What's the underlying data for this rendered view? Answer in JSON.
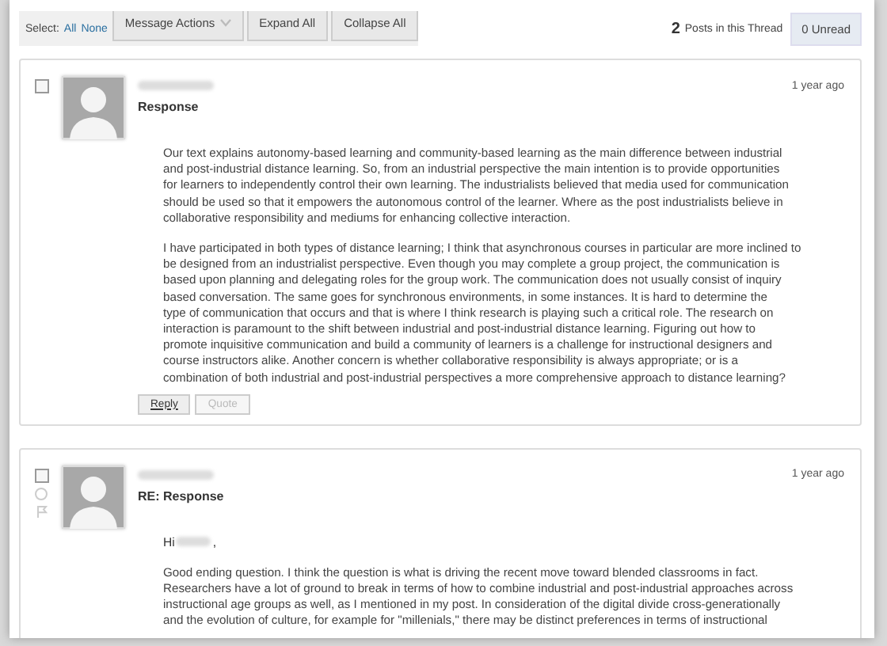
{
  "toolbar": {
    "select_label": "Select:",
    "select_links": [
      "All",
      "None"
    ],
    "buttons": [
      {
        "label": "Message Actions",
        "kind": "dropdown"
      },
      {
        "label": "Expand All",
        "kind": "plain"
      },
      {
        "label": "Collapse All",
        "kind": "plain"
      }
    ],
    "post_count": "2",
    "post_count_label": "Posts in this Thread",
    "unread": "0 Unread"
  },
  "posts": [
    {
      "checked": false,
      "time": "1 year ago",
      "subject": "Response",
      "paragraphs": [
        [
          "Our text explains autonomy-based learning and community-based learning as the main difference between industrial",
          "and post-industrial distance learning.  So, from an industrial perspective the main intention is to provide opportunities",
          "for learners to independently control their own learning.  The industrialists believed that media used for communication",
          "should be used so that it empowers the autonomous control of the learner.  Where as the post industrialists believe in",
          "collaborative responsibility and mediums for enhancing collective interaction."
        ],
        [
          "I have participated in both types of distance learning; I think that asynchronous courses in particular are more inclined to",
          "be designed from an industrialist perspective.  Even though you may complete a group project, the communication is",
          "based upon planning and delegating roles for the group work.  The communication does not usually consist of inquiry",
          "based conversation.  The same goes for synchronous environments, in some instances.  It is hard to determine the",
          "type of communication that occurs and that is where I think research is playing such a critical role.  The research on",
          "interaction is paramount to the shift between industrial and post-industrial distance learning.  Figuring out how to",
          "promote inquisitive communication and build a community of learners is a challenge for instructional designers and",
          "course instructors alike.  Another concern is whether collaborative responsibility is always appropriate; or is a",
          "combination of both industrial and post-industrial perspectives a more comprehensive approach to distance learning?"
        ]
      ],
      "actions": [
        {
          "label": "Reply",
          "disabled": false
        },
        {
          "label": "Quote",
          "disabled": true
        }
      ]
    },
    {
      "checked": false,
      "markers": true,
      "time": "1 year ago",
      "subject": "RE: Response",
      "greeting": {
        "text": "Hi",
        "suffix": ","
      },
      "paragraphs": [
        [
          "Good ending question.  I think the question is what is driving the recent move toward blended classrooms in fact.",
          "Researchers have a lot of ground to break in terms of how to combine industrial and post-industrial approaches across",
          "instructional age groups as well, as I mentioned in my post. In consideration of the digital divide cross-generationally",
          "and the evolution of culture, for example for \"millenials,\" there may be distinct preferences in terms of instructional"
        ]
      ]
    }
  ]
}
